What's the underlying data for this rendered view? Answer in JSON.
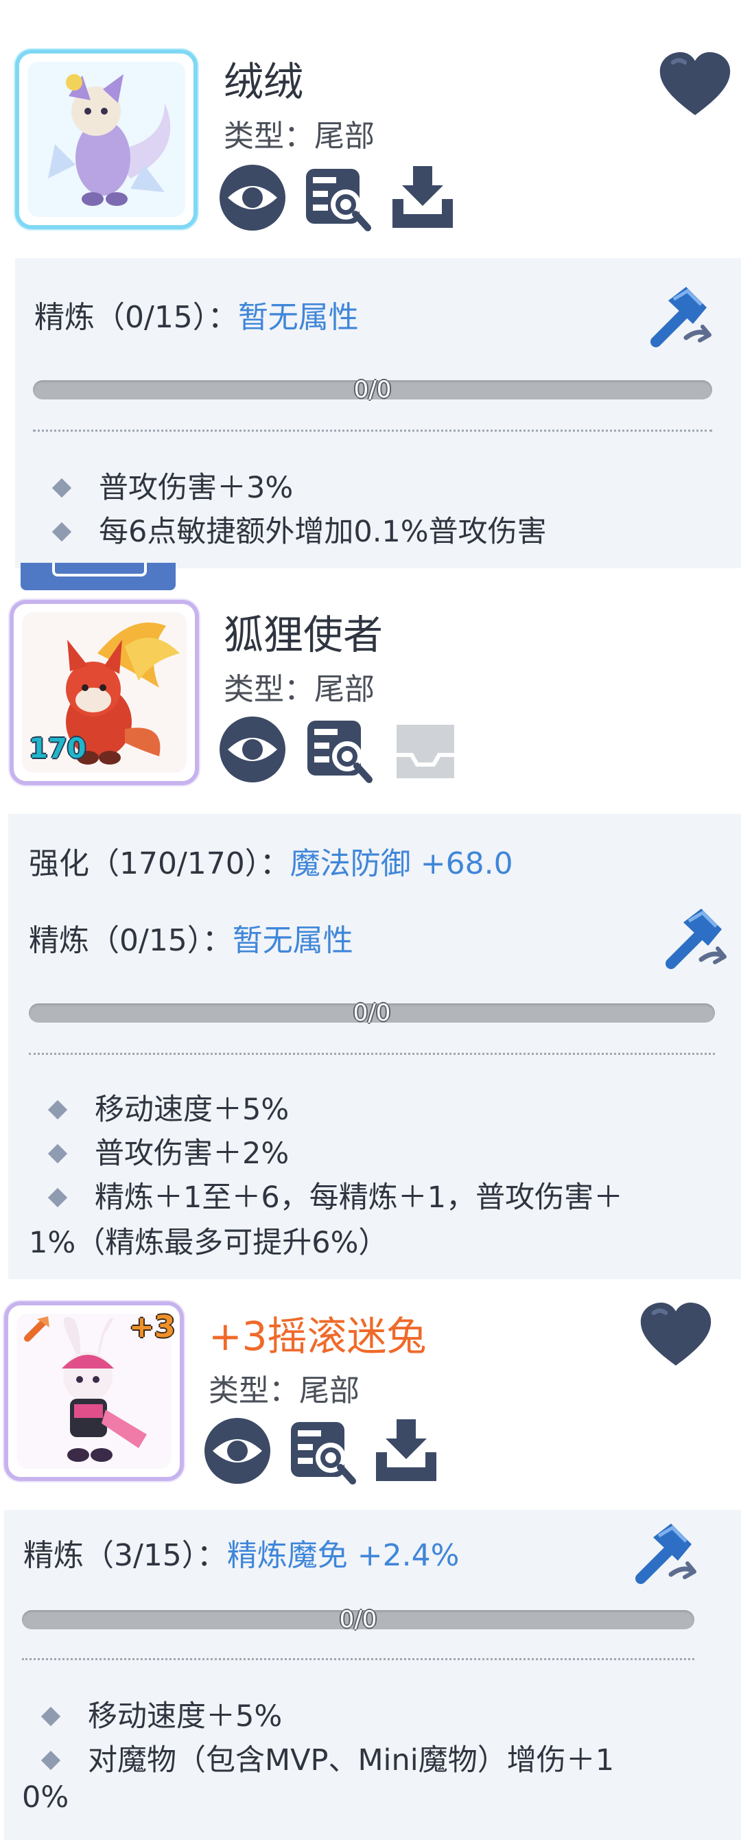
{
  "colors": {
    "accent_blue": "#3f86d9",
    "icon_navy": "#3c4a66",
    "panel_bg": "#f1f4f8",
    "orange_name": "#ef6a2a"
  },
  "items": [
    {
      "name": "绒绒",
      "type": "类型：尾部",
      "refine_label": "精炼（0/15）：",
      "refine_value": "暂无属性",
      "progress": "0/0",
      "effects": [
        "普攻伤害＋3%",
        "每6点敏捷额外增加0.1%普攻伤害"
      ],
      "icons": [
        "eye-icon",
        "inspect-icon",
        "download-icon",
        "heart-icon",
        "refine-hammer-icon"
      ]
    },
    {
      "name": "狐狸使者",
      "type": "类型：尾部",
      "level": "170",
      "enhance_label": "强化（170/170）：",
      "enhance_value": "魔法防御 +68.0",
      "refine_label": "精炼（0/15）：",
      "refine_value": "暂无属性",
      "progress": "0/0",
      "effects": [
        "移动速度＋5%",
        "普攻伤害＋2%",
        "精炼＋1至＋6，每精炼＋1，普攻伤害＋"
      ],
      "effect_wrap": "1%（精炼最多可提升6%）",
      "icons": [
        "eye-icon",
        "inspect-icon",
        "download-disabled-icon",
        "refine-hammer-icon"
      ]
    },
    {
      "name": "+3摇滚迷兔",
      "type": "类型：尾部",
      "plus": "+3",
      "refine_label": "精炼（3/15）：",
      "refine_value": "精炼魔免 +2.4%",
      "progress": "0/0",
      "effects": [
        "移动速度＋5%",
        "对魔物（包含MVP、Mini魔物）增伤＋1"
      ],
      "effect_wrap": "0%",
      "icons": [
        "eye-icon",
        "inspect-icon",
        "download-icon",
        "heart-icon",
        "refine-hammer-icon"
      ]
    }
  ]
}
